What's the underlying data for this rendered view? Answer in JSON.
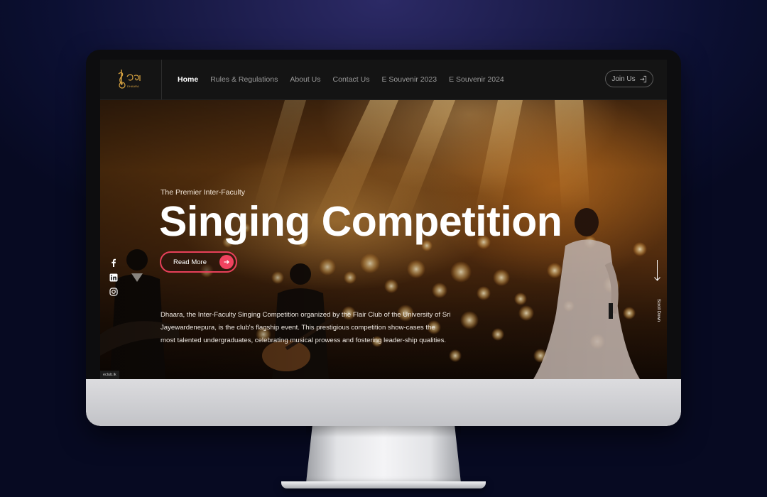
{
  "brand": {
    "logo_text": "DHAARA"
  },
  "nav": {
    "items": [
      {
        "label": "Home",
        "active": true
      },
      {
        "label": "Rules & Regulations"
      },
      {
        "label": "About Us"
      },
      {
        "label": "Contact Us"
      },
      {
        "label": "E Souvenir 2023"
      },
      {
        "label": "E Souvenir 2024"
      }
    ],
    "join_label": "Join Us"
  },
  "hero": {
    "eyebrow": "The Premier Inter-Faculty",
    "headline": "Singing Competition",
    "cta_label": "Read More",
    "description": "Dhaara, the Inter-Faculty Singing Competition organized by the Flair Club of the University of Sri Jayewardenepura, is the club's flagship event. This prestigious competition show-cases the most talented undergraduates, celebrating musical prowess and fostering leader-ship qualities.",
    "scroll_label": "Scroll Down"
  },
  "social": [
    "facebook-icon",
    "linkedin-icon",
    "instagram-icon"
  ],
  "status": {
    "url_text": "eclub.lk"
  },
  "colors": {
    "accent": "#f0435f",
    "background": "#0c1033",
    "nav": "#141414"
  }
}
